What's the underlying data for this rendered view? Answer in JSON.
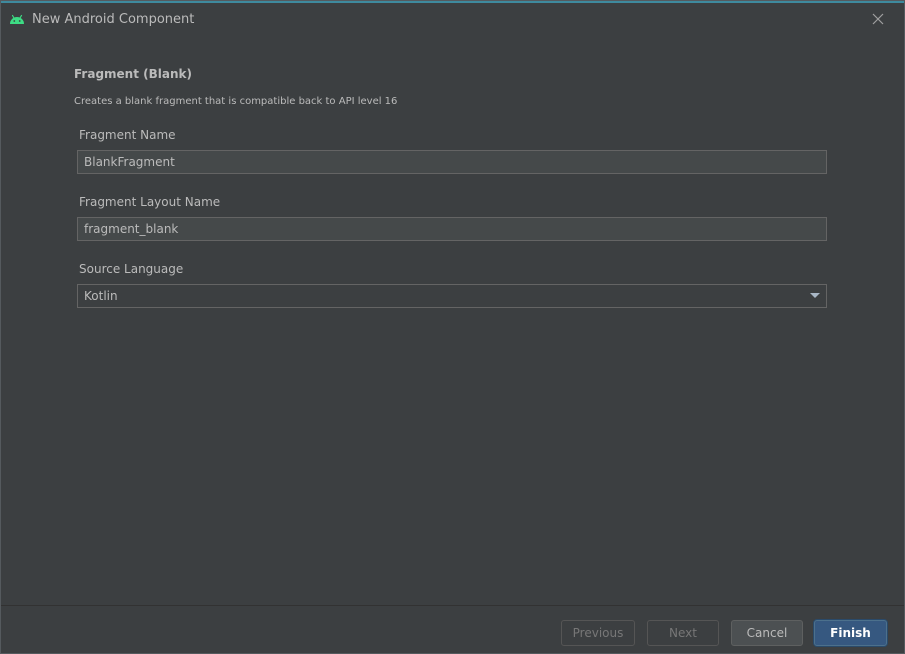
{
  "window": {
    "title": "New Android Component"
  },
  "template": {
    "heading": "Fragment (Blank)",
    "description": "Creates a blank fragment that is compatible back to API level 16"
  },
  "fields": {
    "fragment_name": {
      "label": "Fragment Name",
      "value": "BlankFragment"
    },
    "layout_name": {
      "label": "Fragment Layout Name",
      "value": "fragment_blank"
    },
    "source_language": {
      "label": "Source Language",
      "selected": "Kotlin"
    }
  },
  "footer": {
    "previous_label": "Previous",
    "next_label": "Next",
    "cancel_label": "Cancel",
    "finish_label": "Finish"
  },
  "colors": {
    "background": "#3c3f41",
    "input_background": "#45494a",
    "primary_button": "#365880",
    "android_green": "#3ddc84"
  }
}
